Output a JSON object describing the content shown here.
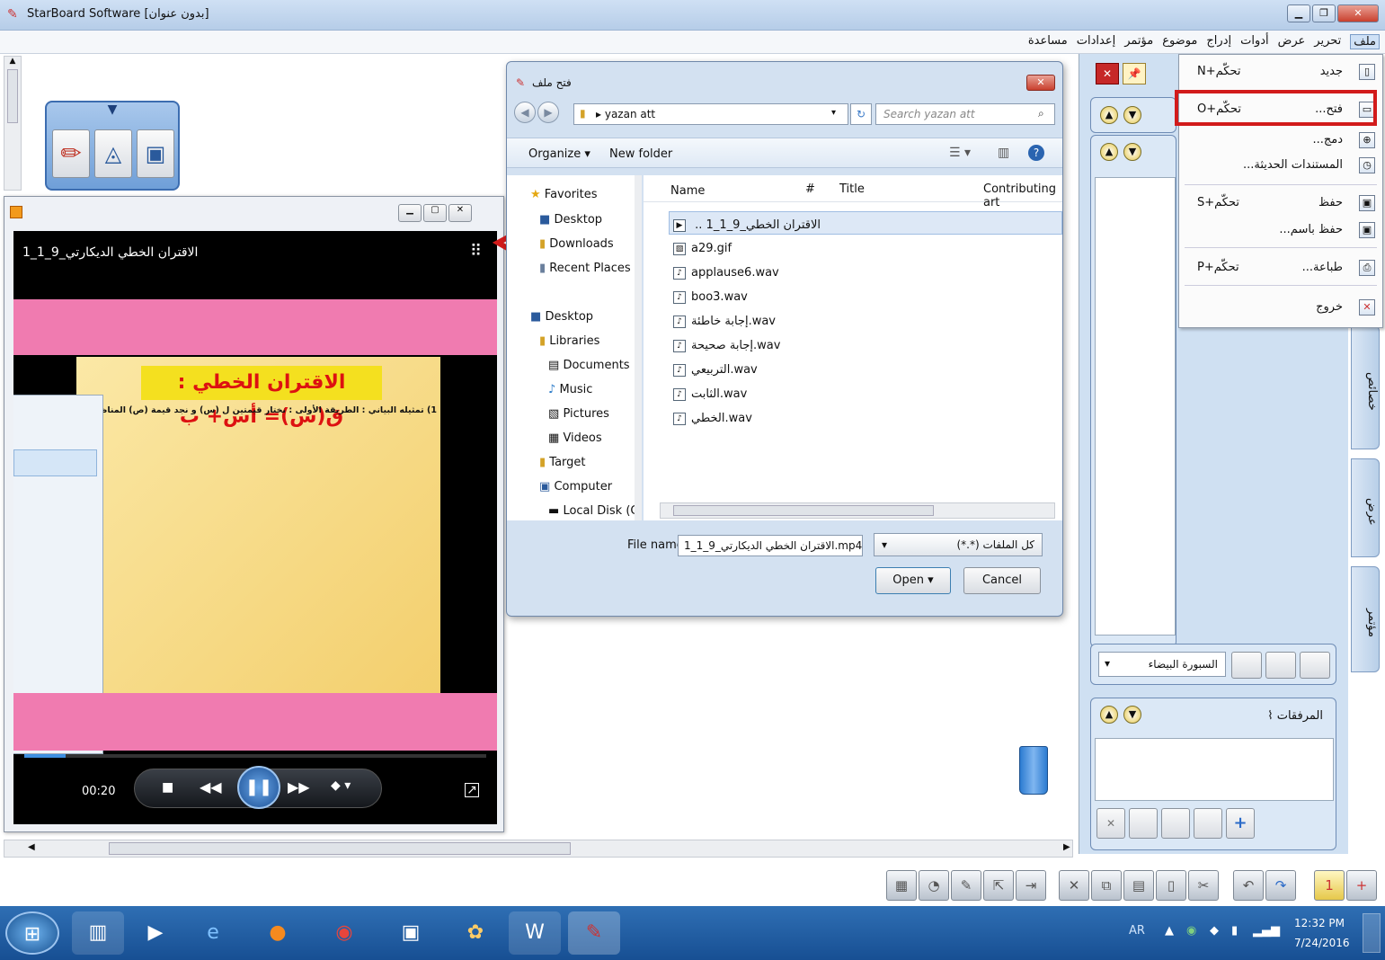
{
  "window": {
    "title": "StarBoard Software [بدون عنوان]"
  },
  "menu_bar": [
    "ملف",
    "تحرير",
    "عرض",
    "أدوات",
    "إدراج",
    "موضوع",
    "مؤتمر",
    "إعدادات",
    "مساعدة"
  ],
  "file_menu": [
    {
      "label": "جديد",
      "shortcut": "تحكّم+N"
    },
    {
      "label": "فتح...",
      "shortcut": "تحكّم+O"
    },
    {
      "label": "دمج...",
      "shortcut": ""
    },
    {
      "label": "المستندات الحديثة...",
      "shortcut": ""
    },
    {
      "label": "حفظ",
      "shortcut": "تحكّم+S"
    },
    {
      "label": "حفظ باسم...",
      "shortcut": ""
    },
    {
      "label": "طباعة...",
      "shortcut": "تحكّم+P"
    },
    {
      "label": "خروج",
      "shortcut": ""
    }
  ],
  "player": {
    "title": "الاقتران الخطي الديكارتي_9_1_1",
    "slide_heading": "الاقتران الخطي : ق(س)= أس+ ب",
    "slide_text": "1) تمثيله البياني : الطريقة الأولى : نختار قيمتين ل (س) و نجد قيمة (ص) المناظرة",
    "time": "00:20",
    "progress": 0.09
  },
  "dialog": {
    "title": "فتح ملف",
    "path": "yazan att",
    "search_placeholder": "Search yazan att",
    "organize": "Organize ▾",
    "new_folder": "New folder",
    "columns": [
      "Name",
      "#",
      "Title",
      "Contributing art"
    ],
    "nav": [
      {
        "label": "Favorites",
        "icon": "star"
      },
      {
        "label": "Desktop",
        "icon": "desktop"
      },
      {
        "label": "Downloads",
        "icon": "folder"
      },
      {
        "label": "Recent Places",
        "icon": "folder"
      },
      {
        "label": "Desktop",
        "icon": "desktop"
      },
      {
        "label": "Libraries",
        "icon": "library"
      },
      {
        "label": "Documents",
        "icon": "doc"
      },
      {
        "label": "Music",
        "icon": "music"
      },
      {
        "label": "Pictures",
        "icon": "picture"
      },
      {
        "label": "Videos",
        "icon": "video"
      },
      {
        "label": "Target",
        "icon": "folder"
      },
      {
        "label": "Computer",
        "icon": "computer"
      },
      {
        "label": "Local Disk (C:)",
        "icon": "disk"
      }
    ],
    "files": [
      "الاقتران الخطي_9_1_1 ..",
      "a29.gif",
      "applause6.wav",
      "boo3.wav",
      "إجابة خاطئة.wav",
      "إجابة صحيحة.wav",
      "التربيعي.wav",
      "الثابت.wav",
      "الخطي.wav"
    ],
    "filename_label": "File name:",
    "filename_value": "الاقتران الخطي الديكارتي_9_1_1.mp4",
    "filetype": "كل الملفات (*.*)",
    "open": "Open",
    "cancel": "Cancel"
  },
  "right_panel": {
    "board_label": "السبورة البيضاء",
    "attachments": "المرفقات",
    "side_tabs": [
      "خصائص",
      "عرض",
      "مؤتمر"
    ]
  },
  "taskbar": {
    "lang": "AR",
    "time": "12:32 PM",
    "date": "7/24/2016"
  },
  "colors": {
    "highlight": "#d21b1b",
    "pink": "#f07bb0",
    "slide_title_bg": "#f4e01f"
  }
}
